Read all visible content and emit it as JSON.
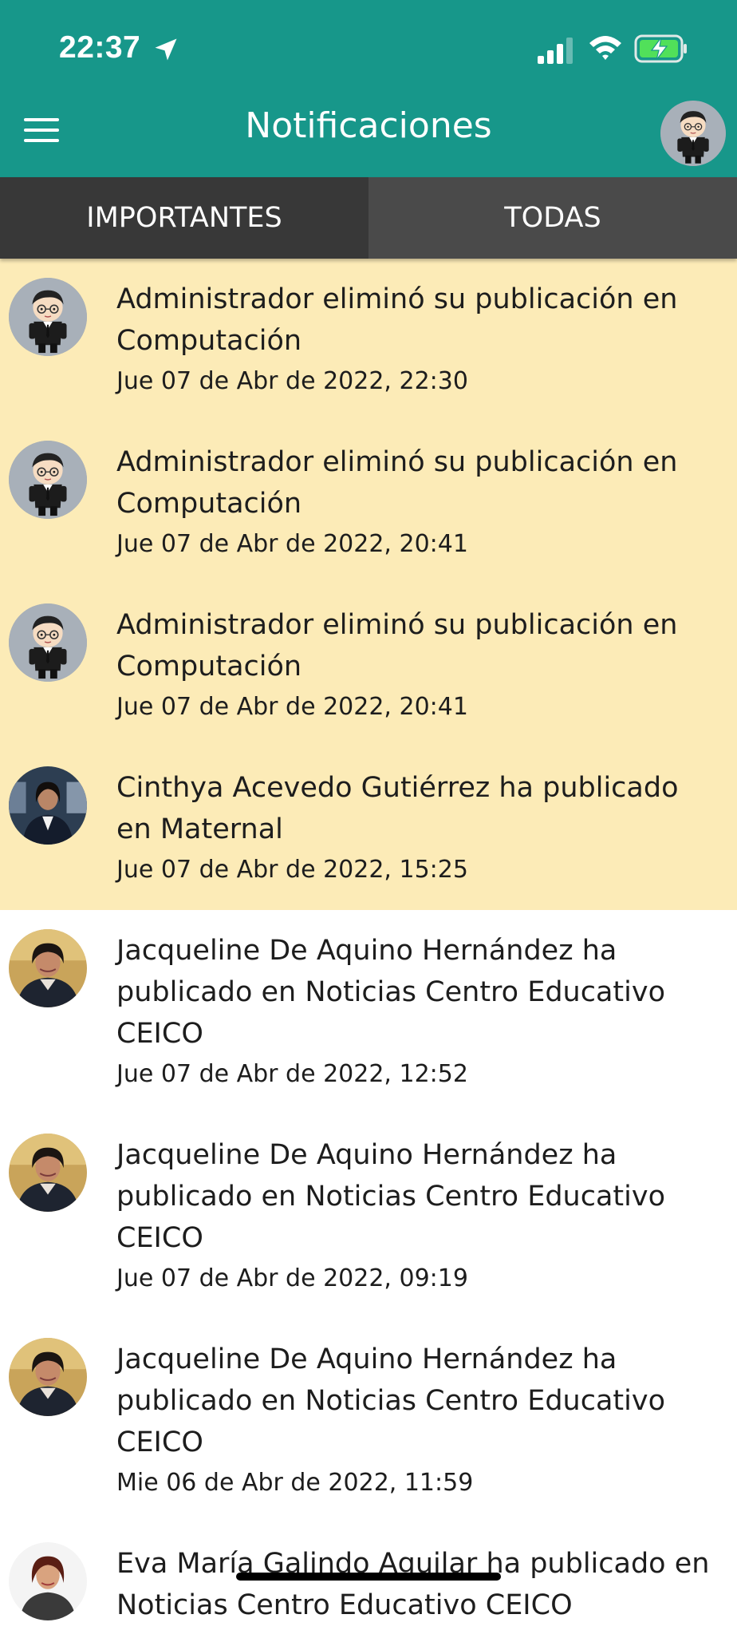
{
  "status_bar": {
    "time": "22:37",
    "icons": [
      "location-arrow-icon",
      "cellular-signal-icon",
      "wifi-icon",
      "battery-charging-icon"
    ]
  },
  "header": {
    "title": "Notificaciones",
    "menu_icon": "hamburger-menu-icon",
    "profile_icon": "profile-avatar"
  },
  "tabs": [
    {
      "label": "IMPORTANTES",
      "active": false
    },
    {
      "label": "TODAS",
      "active": true
    }
  ],
  "colors": {
    "header_bg": "#17978a",
    "tab_bg": "#383838",
    "tab_active_bg": "#4a4a4a",
    "unread_bg": "#fcebb7",
    "read_bg": "#ffffff"
  },
  "notifications": [
    {
      "text": "Administrador eliminó su publicación en Computación",
      "time": "Jue 07 de Abr de 2022, 22:30",
      "unread": true,
      "avatar": "cartoon-admin"
    },
    {
      "text": "Administrador eliminó su publicación en Computación",
      "time": "Jue 07 de Abr de 2022, 20:41",
      "unread": true,
      "avatar": "cartoon-admin"
    },
    {
      "text": "Administrador eliminó su publicación en Computación",
      "time": "Jue 07 de Abr de 2022, 20:41",
      "unread": true,
      "avatar": "cartoon-admin"
    },
    {
      "text": "Cinthya Acevedo Gutiérrez ha publicado en Maternal",
      "time": "Jue 07 de Abr de 2022, 15:25",
      "unread": true,
      "avatar": "photo-woman-dark"
    },
    {
      "text": "Jacqueline De Aquino Hernández ha publicado en Noticias Centro Educativo CEICO",
      "time": "Jue 07 de Abr de 2022, 12:52",
      "unread": false,
      "avatar": "photo-woman"
    },
    {
      "text": "Jacqueline De Aquino Hernández ha publicado en Noticias Centro Educativo CEICO",
      "time": "Jue 07 de Abr de 2022, 09:19",
      "unread": false,
      "avatar": "photo-woman"
    },
    {
      "text": "Jacqueline De Aquino Hernández ha publicado en Noticias Centro Educativo CEICO",
      "time": "Mie 06 de Abr de 2022, 11:59",
      "unread": false,
      "avatar": "photo-woman"
    },
    {
      "text": "Eva María Galindo Aguilar ha publicado en Noticias Centro Educativo CEICO",
      "time": "",
      "unread": false,
      "avatar": "photo-woman-light"
    }
  ]
}
